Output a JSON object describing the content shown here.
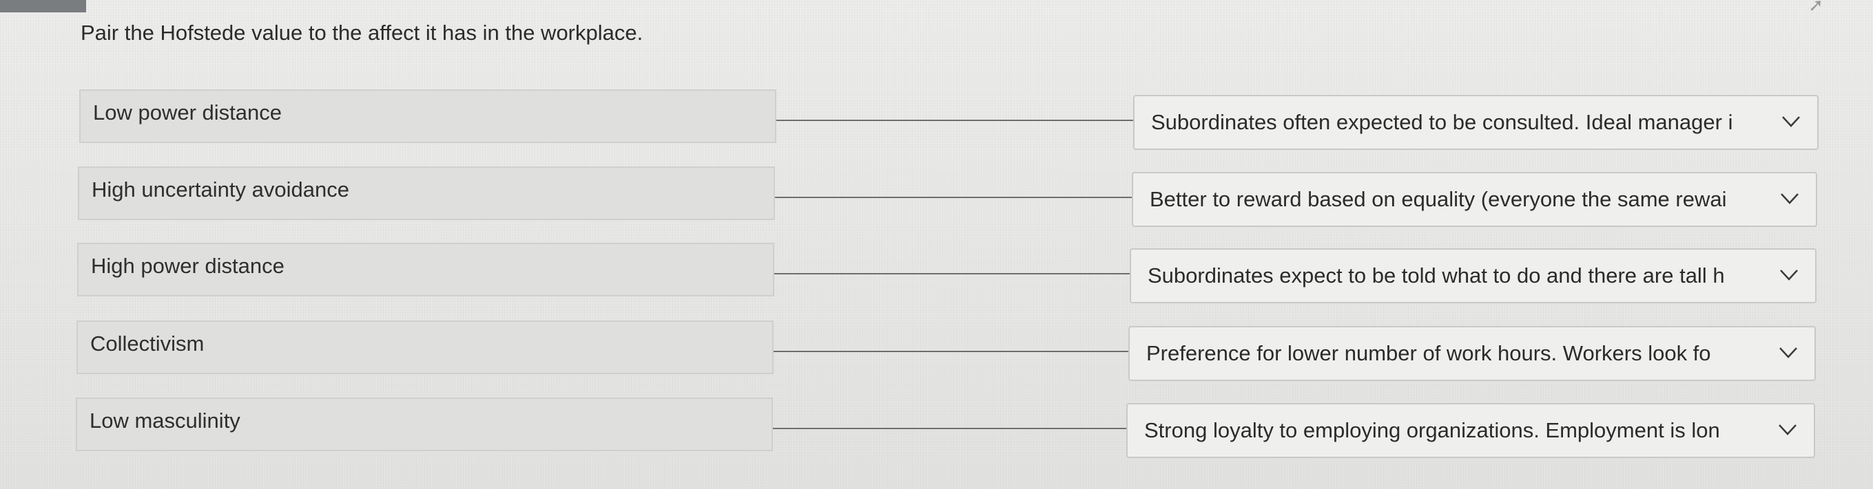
{
  "question": "Pair the Hofstede value to the affect it has in the workplace.",
  "rows": [
    {
      "term": "Low power distance",
      "selected": "Subordinates often expected to be consulted. Ideal manager i"
    },
    {
      "term": "High uncertainty avoidance",
      "selected": "Better to reward based on equality (everyone the same rewai"
    },
    {
      "term": "High power distance",
      "selected": "Subordinates expect to be told what to do and there are tall h"
    },
    {
      "term": "Collectivism",
      "selected": "Preference for lower number of work hours. Workers look fo"
    },
    {
      "term": "Low masculinity",
      "selected": "Strong loyalty to employing organizations. Employment is lon"
    }
  ],
  "icons": {
    "dropdown": "chevron-down-icon"
  }
}
